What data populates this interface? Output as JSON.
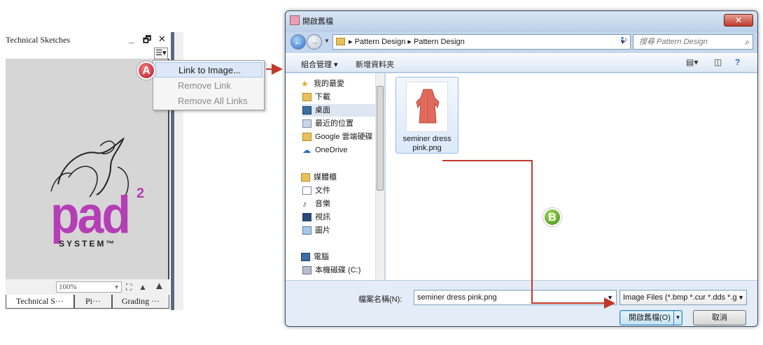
{
  "left_panel": {
    "title": "Technical Sketches",
    "controls": {
      "minimize": "_",
      "maximize": "🗗",
      "close": "✕"
    },
    "logo": {
      "brand": "pad",
      "superscript": "2",
      "subtitle": "SYSTEM™"
    },
    "zoom_value": "100%",
    "tabs": [
      "Technical S···",
      "Pi···",
      "Grading ···"
    ]
  },
  "context_menu": {
    "items": [
      {
        "label": "Link to Image...",
        "state": "highlighted"
      },
      {
        "label": "Remove Link",
        "state": "disabled"
      },
      {
        "label": "Remove All Links",
        "state": "disabled"
      }
    ]
  },
  "badges": {
    "a": "A",
    "b": "B"
  },
  "dialog": {
    "title": "開啟舊檔",
    "close_label": "✕",
    "breadcrumb": [
      "Pattern Design",
      "Pattern Design"
    ],
    "search_placeholder": "搜尋 Pattern Design",
    "toolbar": {
      "organize": "組合管理 ▾",
      "new_folder": "新增資料夾"
    },
    "nav": {
      "favorites": "我的最愛",
      "downloads": "下載",
      "desktop": "桌面",
      "recent_places": "最近的位置",
      "google_drive": "Google 雲端硬碟",
      "onedrive": "OneDrive",
      "libraries": "媒體櫃",
      "documents": "文件",
      "music": "音樂",
      "videos": "視訊",
      "pictures": "圖片",
      "computer": "電腦",
      "local_disk": "本機磁碟 (C:)"
    },
    "file": {
      "name_line1": "seminer dress",
      "name_line2": "pink.png"
    },
    "filename_label": "檔案名稱(N):",
    "filename_value": "seminer dress pink.png",
    "filter": "Image Files (*.bmp *.cur *.dds *.g",
    "open_button": "開啟舊檔(O)",
    "cancel_button": "取消"
  },
  "colors": {
    "accent_red": "#c0392b",
    "brand_purple": "#b43fb5",
    "connector": "#c0392b"
  }
}
